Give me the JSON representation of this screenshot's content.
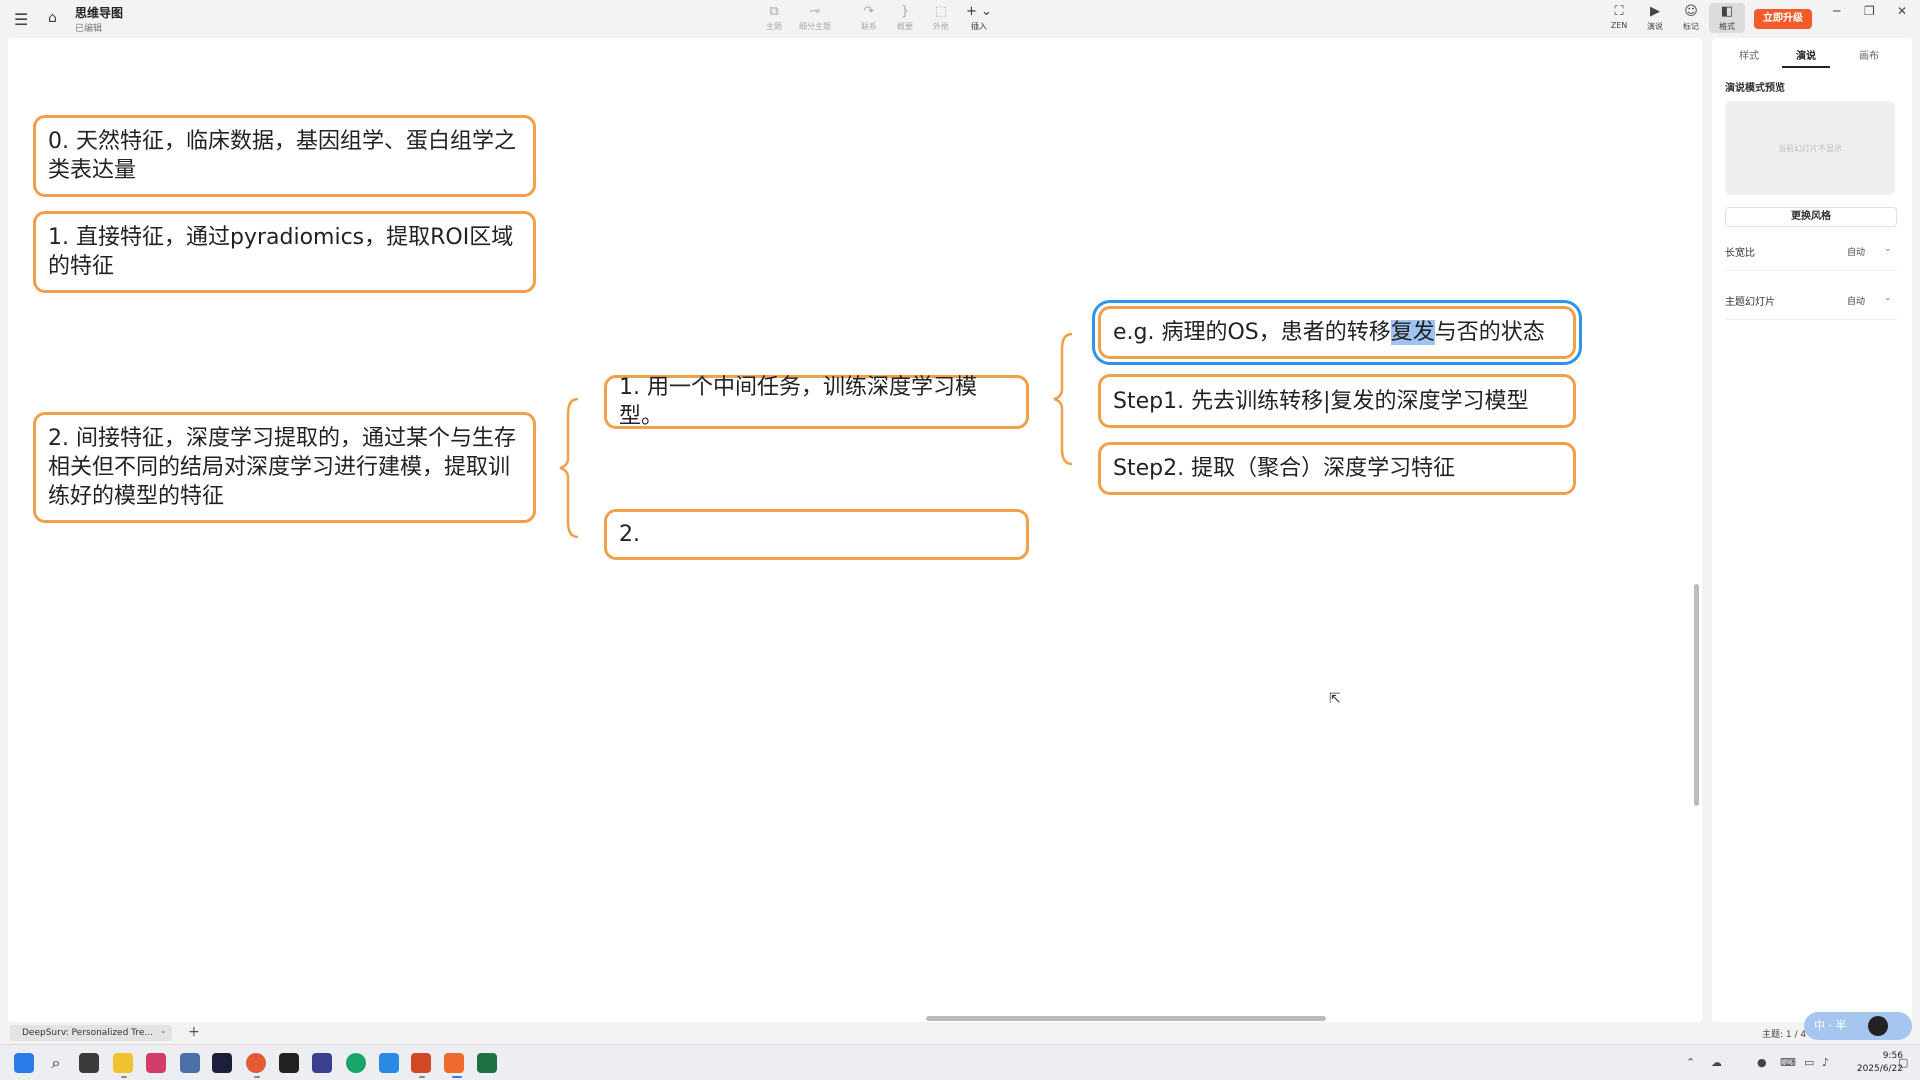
{
  "app": {
    "title": "思维导图",
    "status": "已编辑"
  },
  "toolbar": {
    "tools": [
      {
        "label": "主题",
        "icon": "topic-icon"
      },
      {
        "label": "细分主题",
        "icon": "subtopic-icon"
      },
      {
        "label": "联系",
        "icon": "relationship-icon"
      },
      {
        "label": "概要",
        "icon": "summary-icon"
      },
      {
        "label": "外框",
        "icon": "boundary-icon"
      },
      {
        "label": "插入",
        "icon": "insert-icon"
      }
    ],
    "right_tools": [
      {
        "label": "ZEN",
        "icon": "zen-icon"
      },
      {
        "label": "演说",
        "icon": "pitch-icon"
      },
      {
        "label": "标记",
        "icon": "marker-icon"
      },
      {
        "label": "格式",
        "icon": "format-panel-icon"
      }
    ],
    "upgrade_label": "立即升级"
  },
  "mindmap": {
    "nodes": [
      {
        "id": "n0",
        "text": "0. 天然特征，临床数据，基因组学、蛋白组学之类表达量"
      },
      {
        "id": "n1",
        "text": "1. 直接特征，通过pyradiomics，提取ROI区域的特征"
      },
      {
        "id": "n2",
        "text": "2. 间接特征，深度学习提取的，通过某个与生存相关但不同的结局对深度学习进行建模，提取训练好的模型的特征"
      },
      {
        "id": "n3",
        "text": "1. 用一个中间任务，训练深度学习模型。"
      },
      {
        "id": "n4",
        "text": "2."
      },
      {
        "id": "n5_pre",
        "text": "e.g. 病理的OS，患者的转移"
      },
      {
        "id": "n5_sel",
        "text": "复发"
      },
      {
        "id": "n5_post",
        "text": "与否的状态"
      },
      {
        "id": "n6",
        "text": "Step1. 先去训练转移|复发的深度学习模型"
      },
      {
        "id": "n7",
        "text": "Step2. 提取（聚合）深度学习特征"
      }
    ]
  },
  "panel": {
    "tabs": [
      "样式",
      "演说",
      "画布"
    ],
    "active_tab": "演说",
    "preview_title": "演说模式预览",
    "preview_placeholder": "当前幻灯片不显示",
    "change_style_label": "更换风格",
    "props": [
      {
        "label": "长宽比",
        "value": "自动"
      },
      {
        "label": "主题幻灯片",
        "value": "自动"
      }
    ]
  },
  "sheetbar": {
    "sheet_name": "DeepSurv: Personalized Tre...",
    "topic_count": "主题: 1 / 4"
  },
  "ime": {
    "text": "中 · 半"
  },
  "clock": {
    "time": "9:56",
    "date": "2025/6/22"
  },
  "colors": {
    "node_border": "#f0a04b",
    "selection": "#2c95e8",
    "upgrade": "#f25c2a"
  }
}
